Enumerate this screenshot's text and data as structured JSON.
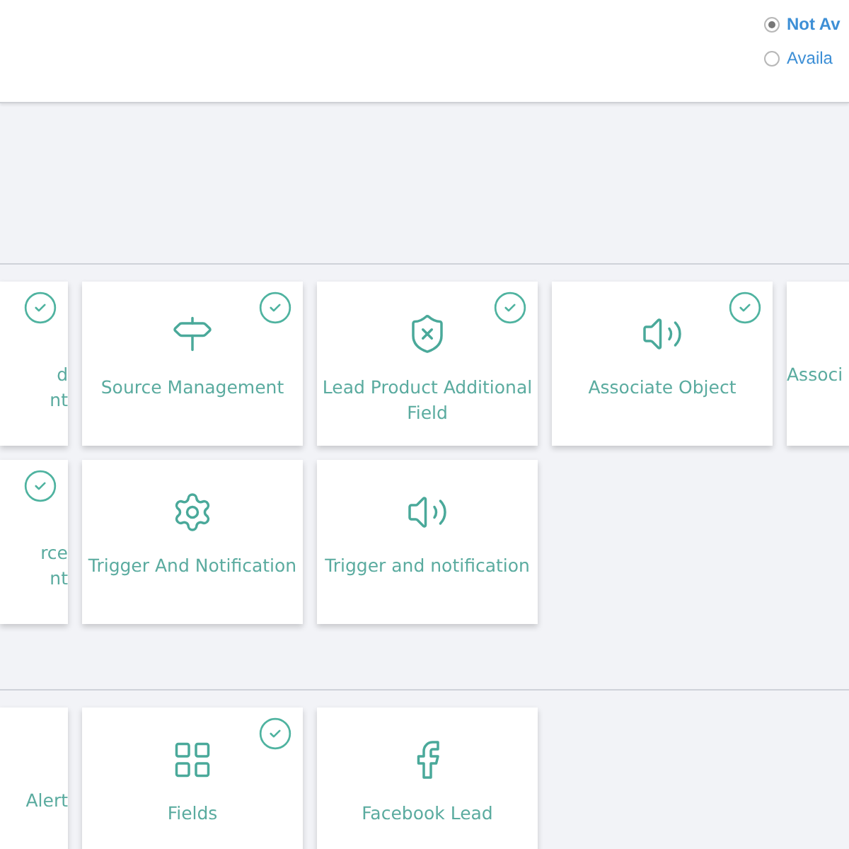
{
  "availability": [
    {
      "label": "Not Av",
      "selected": true
    },
    {
      "label": "Availa",
      "selected": false
    }
  ],
  "sections": [
    {
      "rows": [
        [
          {
            "kind": "cut-left",
            "lines": [
              "d",
              "nt"
            ],
            "checked": true
          },
          {
            "kind": "signpost",
            "lines": [
              "Source Management"
            ],
            "checked": true
          },
          {
            "kind": "shield",
            "lines": [
              "Lead Product Additional",
              "Field"
            ],
            "checked": true
          },
          {
            "kind": "speaker",
            "lines": [
              "Associate Object"
            ],
            "checked": true
          },
          {
            "kind": "cut-right",
            "lines": [
              "Associ"
            ],
            "checked": false
          }
        ],
        [
          {
            "kind": "cut-left",
            "lines": [
              "rce",
              "nt"
            ],
            "checked": true
          },
          {
            "kind": "gear",
            "lines": [
              "Trigger And Notification"
            ],
            "checked": false
          },
          {
            "kind": "speaker",
            "lines": [
              "Trigger and notification"
            ],
            "checked": false
          }
        ]
      ]
    },
    {
      "rows": [
        [
          {
            "kind": "cut-left",
            "lines": [
              "Alert"
            ],
            "checked": false
          },
          {
            "kind": "grid",
            "lines": [
              "Fields"
            ],
            "checked": true
          },
          {
            "kind": "facebook",
            "lines": [
              "Facebook Lead"
            ],
            "checked": false
          }
        ]
      ]
    }
  ]
}
